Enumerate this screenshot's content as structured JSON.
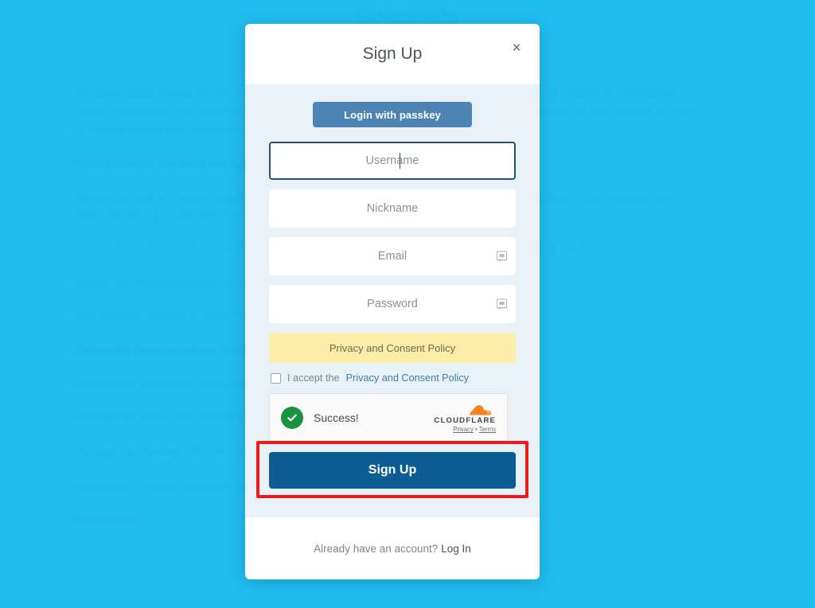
{
  "background_page": {
    "title": "Downloads",
    "paragraphs": [
      "The latest 'stable' release (v4.2.8) will be the final v4.2 maintenance release and there are no plans for another v4.2 maintenance release and therefore we recommend all new installs use the current v4.3 'development' releases, which will soon become the new v4.4 stable release (eta in Q1/2024)."
    ],
    "heading_official": "Official Sources (we build and support)",
    "binaries_text": "Binaries for RedHat, Debian, Raspbian and Ubuntu available from dl.tvheadend.org or you can configure a local apt/dpkg repo to install and stay up to date with Tvheadend:",
    "code_snippet": "curl -fsSL 'https://dl.cloudsmith.io/public/tvheadend/tvheadend/setup.deb.sh' | sudo -E bash",
    "manual_repo_text": "Manual repo setup instructions can be found here.",
    "note_text": "Note: Binaries and repo for CentOS/Fedora are no longer maintained.",
    "heading_community": "Community Sources (others build and support)",
    "community_items": [
      "Packages for rpm distros: https://kodi.wiki/view/Tvheadend",
      "Packages for QNAP NAS devices: https://www.qnapclub.eu/en/qpkg/567",
      "Packages for Synology NAS devices: https://synocommunity.com/package/tvheadend",
      "LinuxServer.io Docker containers: https://hub.docker.com/r/linuxserver/tvheadend"
    ],
    "heading_source": "Source Code"
  },
  "modal": {
    "title": "Sign Up",
    "close_label": "×",
    "passkey_button": "Login with passkey",
    "fields": [
      {
        "name": "username",
        "placeholder": "Username",
        "value": "",
        "focused": true,
        "has_pwmgr_icon": false
      },
      {
        "name": "nickname",
        "placeholder": "Nickname",
        "value": "",
        "focused": false,
        "has_pwmgr_icon": false
      },
      {
        "name": "email",
        "placeholder": "Email",
        "value": "",
        "focused": false,
        "has_pwmgr_icon": true
      },
      {
        "name": "password",
        "placeholder": "Password",
        "value": "",
        "focused": false,
        "has_pwmgr_icon": true
      }
    ],
    "policy_banner": "Privacy and Consent Policy",
    "consent_prefix": "I accept the ",
    "consent_link": "Privacy and Consent Policy",
    "consent_checked": false,
    "captcha": {
      "provider": "Cloudflare Turnstile",
      "status": "Success!",
      "wordmark": "CLOUDFLARE",
      "privacy_label": "Privacy",
      "separator": "•",
      "terms_label": "Terms"
    },
    "submit_button": "Sign Up",
    "footer_text": "Already have an account?",
    "footer_link": "Log In"
  },
  "annotation": {
    "type": "highlight-box",
    "target": "submit_button",
    "color": "#ee1b1b"
  },
  "colors": {
    "page_background": "#21bdf0",
    "modal_body": "#e8f1f5",
    "modal_header": "#ffffff",
    "passkey_button": "#4e84b4",
    "submit_button": "#0d5c94",
    "policy_banner": "#fceea8",
    "focus_ring": "#1f5573",
    "success_green": "#1a9142",
    "cloudflare_orange": "#f6821f",
    "annotation_red": "#ee1b1b"
  }
}
